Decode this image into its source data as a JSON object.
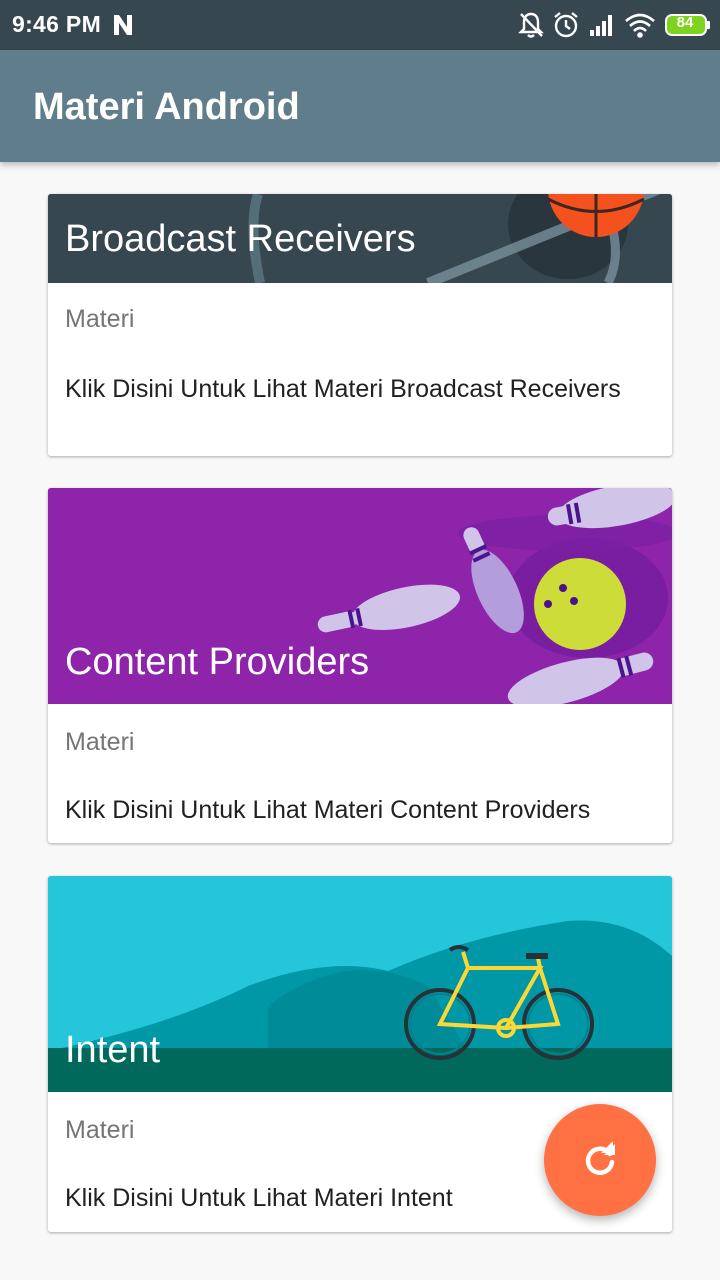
{
  "status_bar": {
    "time": "9:46 PM",
    "battery": "84",
    "icons": [
      "n-icon",
      "bell-off-icon",
      "alarm-icon",
      "signal-icon",
      "wifi-icon",
      "battery-icon"
    ]
  },
  "app_bar": {
    "title": "Materi Android"
  },
  "cards": [
    {
      "title": "Broadcast Receivers",
      "subtitle": "Materi",
      "link": "Klik Disini Untuk Lihat Materi Broadcast Receivers",
      "image": "basketball-illustration",
      "image_color": "#37474f"
    },
    {
      "title": "Content Providers",
      "subtitle": "Materi",
      "link": "Klik Disini Untuk Lihat Materi Content Providers",
      "image": "bowling-illustration",
      "image_color": "#8e24aa"
    },
    {
      "title": "Intent",
      "subtitle": "Materi",
      "link": "Klik Disini Untuk Lihat Materi Intent",
      "image": "bicycle-illustration",
      "image_color": "#26c6da"
    }
  ],
  "fab": {
    "icon": "refresh-icon",
    "color": "#ff7043"
  }
}
